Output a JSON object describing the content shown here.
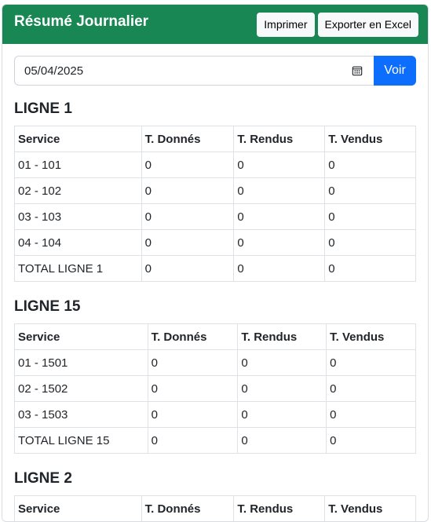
{
  "header": {
    "title": "Résumé Journalier",
    "print_label": "Imprimer",
    "export_label": "Exporter en Excel"
  },
  "filter": {
    "date_value": "05/04/2025",
    "submit_label": "Voir"
  },
  "sections": [
    {
      "title": "LIGNE 1",
      "columns": [
        "Service",
        "T. Donnés",
        "T. Rendus",
        "T. Vendus"
      ],
      "rows": [
        [
          "01 - 101",
          "0",
          "0",
          "0"
        ],
        [
          "02 - 102",
          "0",
          "0",
          "0"
        ],
        [
          "03 - 103",
          "0",
          "0",
          "0"
        ],
        [
          "04 - 104",
          "0",
          "0",
          "0"
        ],
        [
          "TOTAL LIGNE 1",
          "0",
          "0",
          "0"
        ]
      ]
    },
    {
      "title": "LIGNE 15",
      "columns": [
        "Service",
        "T. Donnés",
        "T. Rendus",
        "T. Vendus"
      ],
      "rows": [
        [
          "01 - 1501",
          "0",
          "0",
          "0"
        ],
        [
          "02 - 1502",
          "0",
          "0",
          "0"
        ],
        [
          "03 - 1503",
          "0",
          "0",
          "0"
        ],
        [
          "TOTAL LIGNE 15",
          "0",
          "0",
          "0"
        ]
      ]
    },
    {
      "title": "LIGNE 2",
      "columns": [
        "Service",
        "T. Donnés",
        "T. Rendus",
        "T. Vendus"
      ],
      "rows": []
    }
  ],
  "icons": {
    "date_picker": "calendar-icon"
  },
  "colors": {
    "header_bg": "#198754",
    "primary": "#0d6efd"
  }
}
